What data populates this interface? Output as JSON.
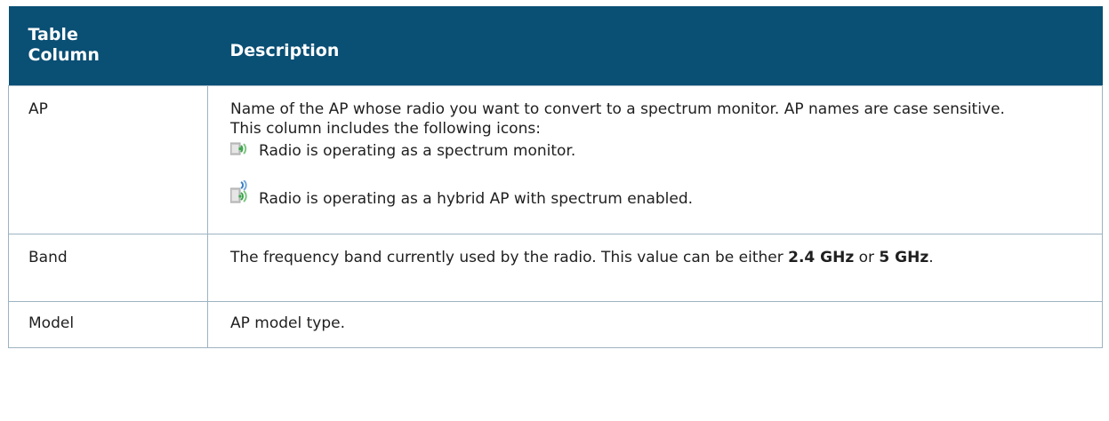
{
  "header": {
    "col1": "Table Column",
    "col1_line1": "Table",
    "col1_line2": "Column",
    "col2": "Description"
  },
  "rows": [
    {
      "column": "AP",
      "desc_line1": "Name of the AP whose radio you want to convert to a spectrum monitor. AP names are case sensitive.",
      "desc_line2": "This column includes the following icons:",
      "icons": [
        {
          "icon": "spectrum-monitor-icon",
          "text": "Radio is operating as a spectrum monitor."
        },
        {
          "icon": "hybrid-ap-icon",
          "text": "Radio is operating as a hybrid AP with spectrum enabled."
        }
      ]
    },
    {
      "column": "Band",
      "desc_pre": "The frequency band currently used by the radio. This value can be either ",
      "desc_b1": "2.4 GHz",
      "desc_mid": " or ",
      "desc_b2": "5 GHz",
      "desc_post": "."
    },
    {
      "column": "Model",
      "desc": "AP model type."
    }
  ],
  "colors": {
    "header_bg": "#0a4f74",
    "border": "#9db3c1",
    "icon_green": "#3aa64a"
  }
}
